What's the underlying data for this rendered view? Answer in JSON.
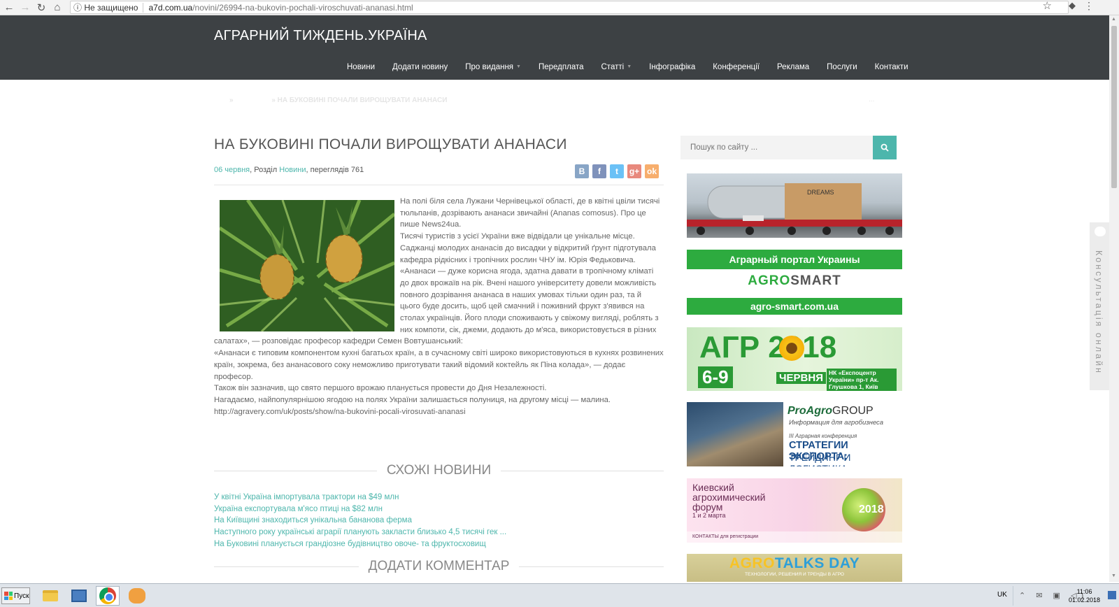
{
  "browser": {
    "security": "Не защищено",
    "url_host": "a7d.com.ua",
    "url_path": "/novini/26994-na-bukovin-pochali-viroschuvati-ananasi.html"
  },
  "site": {
    "title": "АГРАРНИЙ ТИЖДЕНЬ.УКРАЇНА",
    "nav": [
      "Новини",
      "Додати новину",
      "Про видання",
      "Передплата",
      "Статті",
      "Інфографіка",
      "Конференції",
      "Реклама",
      "Послуги",
      "Контакти"
    ]
  },
  "breadcrumb": {
    "sep1": "»",
    "current": "» НА БУКОВИНІ ПОЧАЛИ ВИРОЩУВАТИ АНАНАСИ",
    "right": "..."
  },
  "article": {
    "title": "НА БУКОВИНІ ПОЧАЛИ ВИРОЩУВАТИ АНАНАСИ",
    "date": "06 червня",
    "section_prefix": ", Розділ ",
    "section": "Новини",
    "views": ", переглядів 761",
    "paragraphs": [
      "На полі біля села Лужани Чернівецької області, де в квітні цвіли тисячі тюльпанів, дозрівають ананаси звичайні (Ananas comosus). Про це пише News24ua.",
      "Тисячі туристів з усієї України вже відвідали це унікальне місце. Саджанці молодих ананасів до висадки у відкритий ґрунт підготувала кафедра рідкісних і тропічних рослин ЧНУ ім. Юрія Федьковича.",
      "«Ананаси — дуже корисна ягода, здатна давати в тропічному кліматі до двох врожаїв на рік. Вчені нашого університету довели можливість повного дозрівання ананаса в наших умовах тільки один раз, та й цього буде досить, щоб цей смачний і поживний фрукт з'явився на столах українців. Його плоди споживають у свіжому вигляді, роблять з них компоти, сік, джеми, додають до м'яса, використовується в різних салатах», — розповідає професор кафедри Семен Вовтушанський:",
      "«Ананаси є типовим компонентом кухні багатьох країн, а в сучасному світі широко використовуються в кухнях розвинених країн, зокрема, без ананасового соку неможливо приготувати такий відомий коктейль як Піна колада», — додає професор.",
      "Також він зазначив, що свято першого врожаю планується провести до Дня Незалежності.",
      "Нагадаємо, найпопулярнішою ягодою на полях України залишається полуниця, на другому місці — малина.",
      "http://agravery.com/uk/posts/show/na-bukovini-pocali-virosuvati-ananasi"
    ]
  },
  "related": {
    "heading": "СХОЖІ НОВИНИ",
    "items": [
      "У квітні Україна імпортувала трактори на $49 млн",
      "Україна експортувала м'ясо птиці на $82 млн",
      "На Київщині знаходиться унікальна бананова ферма",
      "Наступного року українські аграрії планують закласти близько 4,5 тисячі гек ...",
      "На Буковині планується грандіозне будівництво овоче- та фруктосховищ"
    ]
  },
  "comments": {
    "heading": "ДОДАТИ КОММЕНТАР"
  },
  "sidebar": {
    "search_placeholder": "Пошук по сайту ...",
    "b1_truck": "DREAMS",
    "b2_top": "Аграрный портал Украины",
    "b2_logo_a": "AGRO",
    "b2_logo_b": "SMART",
    "b2_url": "agro-smart.com.ua",
    "b3_title": "АГР 2018",
    "b3_dates": "6-9",
    "b3_month": "ЧЕРВНЯ",
    "b3_venue": "НК «Експоцентр України» пр-т Ак. Глушкова 1, Київ",
    "b4_brand": "ProAgro",
    "b4_group": "GROUP",
    "b4_sub": "Информация для агробизнеса",
    "b4_conf": "III Аграрная конференция",
    "b4_strat1": "СТРАТЕГИИ ЭКСПОРТА:",
    "b4_strat2": "ТРЕЙДИНГ И ЛОГИСТИКА",
    "b5_title": "Киевский агрохимический форум",
    "b5_date": "1 и 2 марта",
    "b5_year": "2018",
    "b5_foot": "КОНТАКТЫ для регистрации",
    "b6_a": "AGRO",
    "b6_b": "TALKS DAY",
    "b6_sub": "ТЕХНОЛОГИИ, РЕШЕНИЯ И ТРЕНДЫ В АГРО"
  },
  "consult": "Консультація онлайн",
  "taskbar": {
    "start": "Пуск",
    "lang": "UK",
    "time": "11:06",
    "date": "01.02.2018"
  },
  "colors": {
    "accent": "#4db6ac",
    "header": "#3d4144"
  }
}
